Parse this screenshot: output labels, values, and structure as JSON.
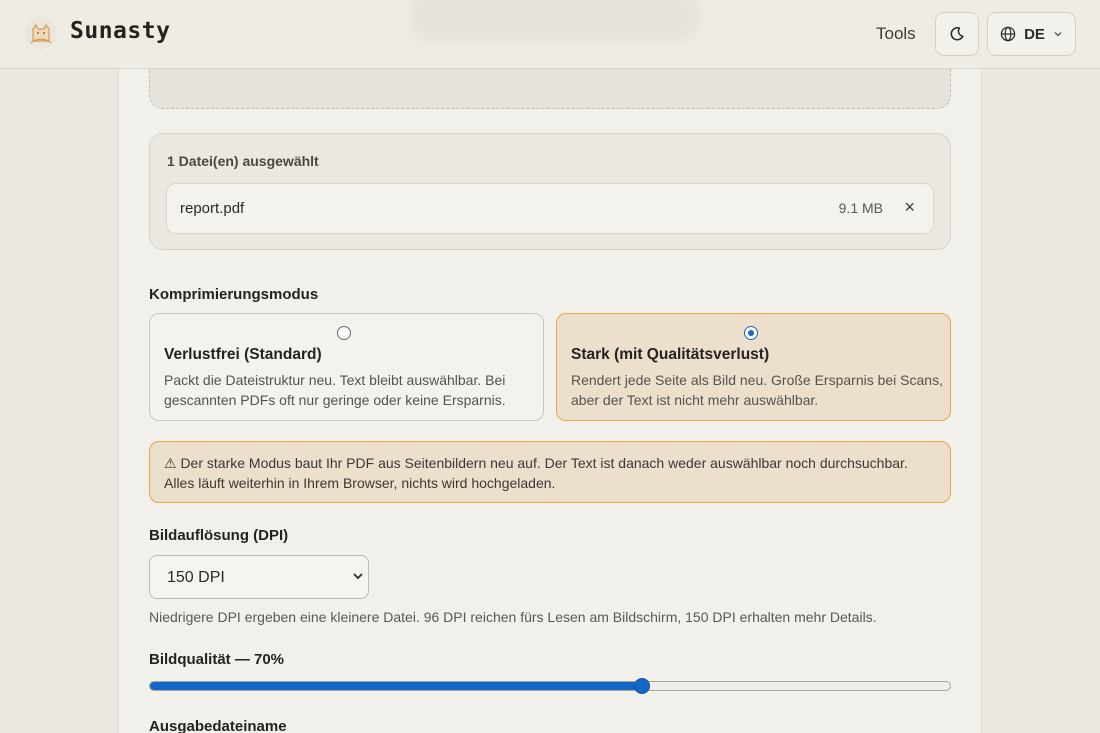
{
  "header": {
    "brand": "Sunasty",
    "nav_tools": "Tools",
    "language": "DE",
    "logo_icon": "cat-logo-icon",
    "theme_icon": "moon-icon",
    "language_icon": "globe-icon",
    "language_chevron_icon": "chevron-down-icon"
  },
  "files": {
    "title": "1 Datei(en) ausgewählt",
    "items": [
      {
        "name": "report.pdf",
        "size": "9.1 MB",
        "remove": "×"
      }
    ]
  },
  "mode": {
    "label": "Komprimierungsmodus",
    "options": [
      {
        "title": "Verlustfrei (Standard)",
        "description": "Packt die Dateistruktur neu. Text bleibt auswählbar. Bei gescannten PDFs oft nur geringe oder keine Ersparnis.",
        "selected": false
      },
      {
        "title": "Stark (mit Qualitätsverlust)",
        "description": "Rendert jede Seite als Bild neu. Große Ersparnis bei Scans, aber der Text ist nicht mehr auswählbar.",
        "selected": true
      }
    ]
  },
  "warning": {
    "text": "⚠ Der starke Modus baut Ihr PDF aus Seitenbildern neu auf. Der Text ist danach weder auswählbar noch durchsuchbar. Alles läuft weiterhin in Ihrem Browser, nichts wird hochgeladen."
  },
  "dpi": {
    "label": "Bildauflösung (DPI)",
    "selected": "150 DPI",
    "hint": "Niedrigere DPI ergeben eine kleinere Datei. 96 DPI reichen fürs Lesen am Bildschirm, 150 DPI erhalten mehr Details."
  },
  "quality": {
    "label": "Bildqualität — 70%",
    "value_fraction": 0.615
  },
  "output": {
    "label": "Ausgabedateiname"
  },
  "colors": {
    "accent": "#1467c4",
    "warning_border": "#e3a74a",
    "warning_bg": "#ecdfcb"
  }
}
